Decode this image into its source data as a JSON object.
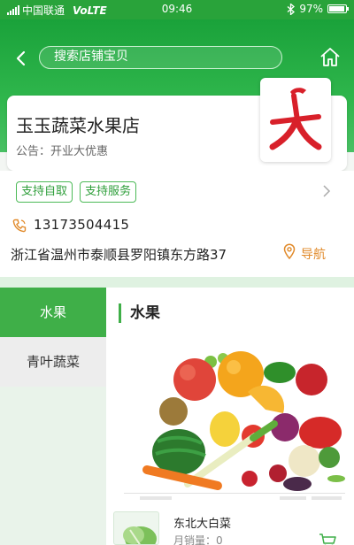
{
  "status_bar": {
    "carrier": "中国联通",
    "network": "VoLTE",
    "time": "09:46",
    "bluetooth_icon": "bluetooth-icon",
    "battery_text": "97%",
    "battery_level": 0.97
  },
  "header": {
    "search_placeholder": "搜索店铺宝贝",
    "back_icon": "chevron-left-icon",
    "home_icon": "home-icon"
  },
  "store": {
    "name": "玉玉蔬菜水果店",
    "notice": "公告：开业大优惠",
    "logo_icon": "store-logo"
  },
  "info": {
    "tags": [
      "支持自取",
      "支持服务"
    ],
    "phone": "13173504415",
    "address": "浙江省温州市泰顺县罗阳镇东方路37",
    "nav_label": "导航"
  },
  "categories": [
    {
      "label": "水果",
      "active": true
    },
    {
      "label": "青叶蔬菜",
      "active": false
    }
  ],
  "section": {
    "title": "水果"
  },
  "product": {
    "name": "东北大白菜",
    "sales": "月销量：0"
  },
  "colors": {
    "brand_green": "#29a33a",
    "accent_orange": "#e18a2a",
    "logo_red": "#d8202a"
  }
}
